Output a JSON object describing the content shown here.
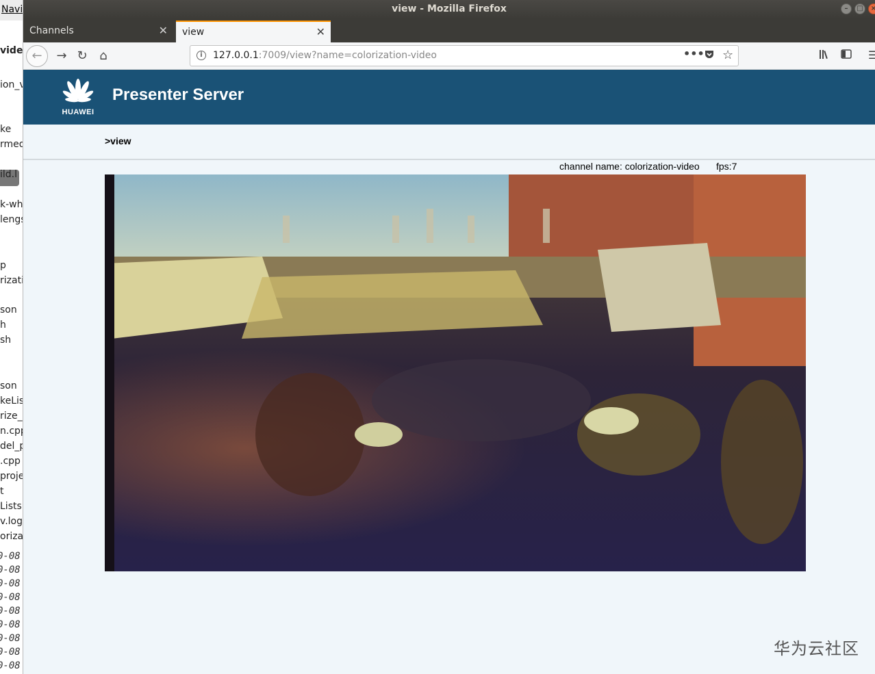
{
  "background_window": {
    "menu_label": "Navi",
    "lines": [
      "video",
      "ion_v",
      "ke",
      "rmed",
      "ild.l",
      "k-wh",
      "lengs",
      "p",
      "rizati",
      "son",
      "h",
      "sh",
      "son",
      "keLis",
      "rize_",
      "n.cpp",
      "del_pr",
      ".cpp",
      "proje",
      "t",
      "Lists.",
      "v.log",
      "orizat"
    ],
    "date_fragments": [
      "0-08",
      "0-08",
      "0-08",
      "0-08",
      "0-08",
      "0-08",
      "0-08",
      "0-08",
      "0-08"
    ]
  },
  "window": {
    "title": "view - Mozilla Firefox"
  },
  "tabs": [
    {
      "label": "Channels",
      "active": false
    },
    {
      "label": "view",
      "active": true
    }
  ],
  "new_tab_symbol": "+",
  "address_bar": {
    "host": "127.0.0.1",
    "rest": ":7009/view?name=colorization-video"
  },
  "icons": {
    "back": "back-arrow-icon",
    "forward": "forward-arrow-icon",
    "reload": "reload-icon",
    "home": "home-icon",
    "info": "info-icon",
    "more": "more-icon",
    "pocket": "pocket-icon",
    "bookmark": "star-icon",
    "library": "library-icon",
    "sidebar": "sidebar-icon",
    "menu": "hamburger-menu-icon"
  },
  "app": {
    "brand": "HUAWEI",
    "title": "Presenter Server",
    "breadcrumb": ">view",
    "channel_label": "channel name: colorization-video",
    "fps_label": "fps:7"
  },
  "watermark": "华为云社区",
  "colors": {
    "header_bg": "#1a5276",
    "page_bg": "#f0f6fa",
    "titlebar_bg": "#3c3b37",
    "active_tab_accent": "#ff9400"
  }
}
